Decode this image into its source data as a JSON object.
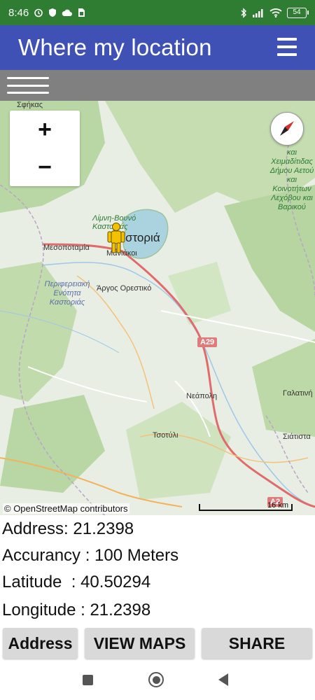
{
  "status_bar": {
    "time": "8:46",
    "battery": "54"
  },
  "app_bar": {
    "title": "Where my location"
  },
  "map": {
    "zoom_in": "+",
    "zoom_out": "−",
    "attribution": "© OpenStreetMap contributors",
    "scale": "16 km",
    "labels": {
      "kastoria": "Καστοριά",
      "lake": "Λίμνη-Βουνό Καστοριάς",
      "mesopotamia": "Μεσοποταμία",
      "maniakoi": "Μανιάκοι",
      "argos": "Άργος Ορεστικό",
      "region": "Περιφερειακή Ενότητα Καστοριάς",
      "neapoli": "Νεάπολη",
      "tsotyli": "Τσοτύλι",
      "galatini": "Γαλατινή",
      "siatista": "Σιάτιστα",
      "sfika": "Σφήκας",
      "right_area": "και Χειμαδίτιδας Δήμου Αετού και Κοινοτήτων Λεχόβου και Βαρικού",
      "a29": "A29",
      "a2": "A2"
    }
  },
  "info": {
    "address": "Address: 21.2398",
    "accuracy_label": "Accurancy : ",
    "accuracy_value": "100 Meters",
    "latitude_label": "Latitude  : ",
    "latitude_value": "40.50294",
    "longitude_label": "Longitude : ",
    "longitude_value": "21.2398"
  },
  "buttons": {
    "address": "Address",
    "view_maps": "VIEW MAPS",
    "share": "SHARE"
  }
}
